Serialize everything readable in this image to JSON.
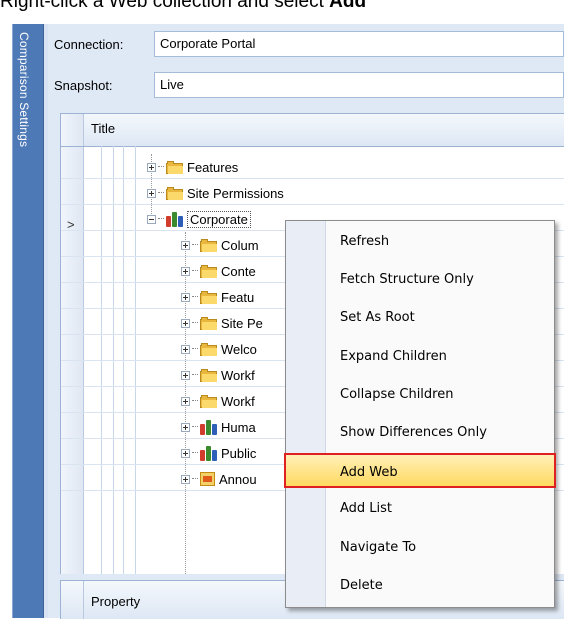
{
  "caption": {
    "prefix": "Right-click a Web collection and select ",
    "bold": "Add"
  },
  "side_tab": {
    "label": "Comparison Settings"
  },
  "form": {
    "connection_label": "Connection:",
    "connection_value": "Corporate Portal",
    "snapshot_label": "Snapshot:",
    "snapshot_value": "Live"
  },
  "grid": {
    "title_header": "Title",
    "row_indicator": ">",
    "rows": [
      {
        "label": "Features",
        "icon": "folder-icon"
      },
      {
        "label": "Site Permissions",
        "icon": "folder-icon"
      },
      {
        "label": "Corporate",
        "icon": "web-icon"
      },
      {
        "label": "Colum",
        "icon": "folder-icon"
      },
      {
        "label": "Conte",
        "icon": "folder-icon"
      },
      {
        "label": "Featu",
        "icon": "folder-icon"
      },
      {
        "label": "Site Pe",
        "icon": "folder-icon"
      },
      {
        "label": "Welco",
        "icon": "folder-icon"
      },
      {
        "label": "Workf",
        "icon": "folder-icon"
      },
      {
        "label": "Workf",
        "icon": "folder-icon"
      },
      {
        "label": "Huma",
        "icon": "web-icon"
      },
      {
        "label": "Public",
        "icon": "web-icon"
      },
      {
        "label": "Annou",
        "icon": "list-icon"
      }
    ]
  },
  "property_grid": {
    "header": "Property"
  },
  "context_menu": {
    "items": [
      "Refresh",
      "Fetch Structure Only",
      "Set As Root",
      "Expand Children",
      "Collapse Children",
      "Show Differences Only",
      "Add Web",
      "Add List",
      "Navigate To",
      "Delete"
    ],
    "highlighted": "Add Web"
  },
  "colors": {
    "accent": "#4e79b7",
    "highlight_border": "#e02020",
    "highlight_fill": "#ffd960"
  }
}
